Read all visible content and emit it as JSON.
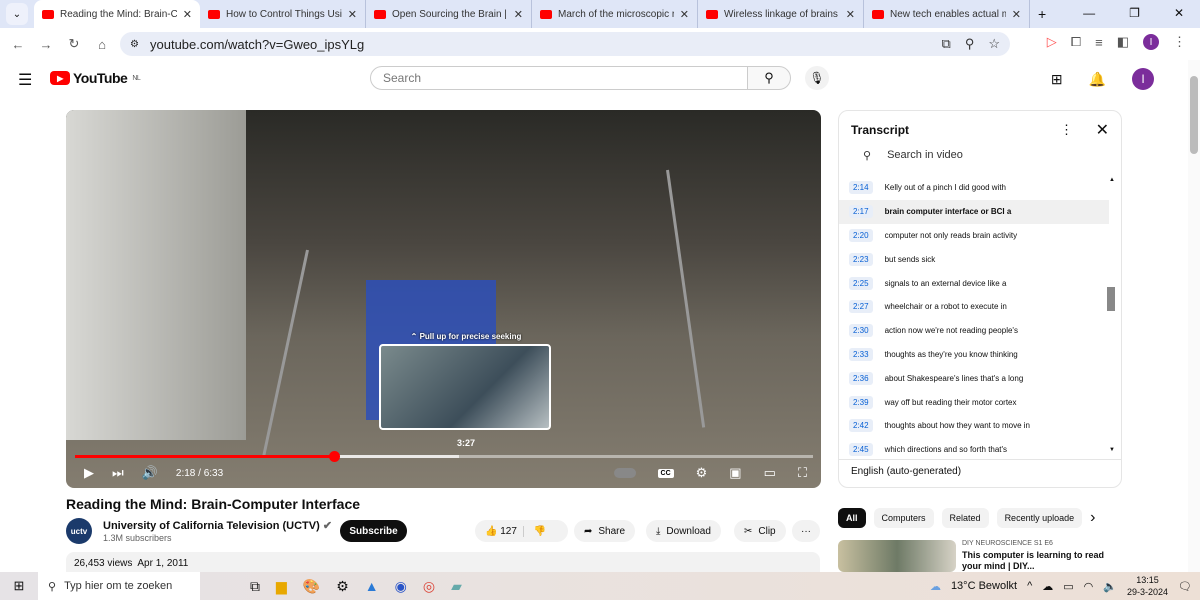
{
  "browser": {
    "tabs": [
      {
        "title": "Reading the Mind: Brain-C",
        "active": true
      },
      {
        "title": "How to Control Things Usi"
      },
      {
        "title": "Open Sourcing the Brain |"
      },
      {
        "title": "March of the microscopic r"
      },
      {
        "title": "Wireless linkage of brains r"
      },
      {
        "title": "New tech enables actual m"
      }
    ],
    "url": "youtube.com/watch?v=Gweo_ipsYLg",
    "profile_initial": "I"
  },
  "youtube": {
    "logo_text": "YouTube",
    "region": "NL",
    "search_placeholder": "Search",
    "avatar_initial": "I"
  },
  "player": {
    "pull_hint": "Pull up for precise seeking",
    "hover_time": "3:27",
    "current_time": "2:18",
    "duration": "6:33",
    "time_display": "2:18 / 6:33",
    "progress_fraction": 0.351,
    "cc_label": "CC",
    "accent_color": "#ff0000"
  },
  "video": {
    "title": "Reading the Mind: Brain-Computer Interface",
    "channel_logo": "uctv",
    "channel": "University of California Television (UCTV)",
    "subscribers": "1.3M subscribers",
    "subscribe_label": "Subscribe",
    "likes": "127",
    "share_label": "Share",
    "download_label": "Download",
    "clip_label": "Clip",
    "views": "26,453 views",
    "date": "Apr 1, 2011"
  },
  "transcript": {
    "title": "Transcript",
    "search_placeholder": "Search in video",
    "language": "English (auto-generated)",
    "lines": [
      {
        "t": "2:14",
        "text": "Kelly out of a pinch I did good with"
      },
      {
        "t": "2:17",
        "text": "brain computer interface or BCI a",
        "active": true
      },
      {
        "t": "2:20",
        "text": "computer not only reads brain activity"
      },
      {
        "t": "2:23",
        "text": "but sends sick"
      },
      {
        "t": "2:25",
        "text": "signals to an external device like a"
      },
      {
        "t": "2:27",
        "text": "wheelchair or a robot to execute in"
      },
      {
        "t": "2:30",
        "text": "action now we're not reading people's"
      },
      {
        "t": "2:33",
        "text": "thoughts as they're you know thinking"
      },
      {
        "t": "2:36",
        "text": "about Shakespeare's lines that's a long"
      },
      {
        "t": "2:39",
        "text": "way off but reading their motor cortex"
      },
      {
        "t": "2:42",
        "text": "thoughts about how they want to move in"
      },
      {
        "t": "2:45",
        "text": "which directions and so forth that's"
      }
    ]
  },
  "chips": [
    "All",
    "Computers",
    "Related",
    "Recently uploade"
  ],
  "recommendation": {
    "meta": "DIY NEUROSCIENCE  S1 E6",
    "title": "This computer is learning to read your mind | DIY..."
  },
  "taskbar": {
    "search_placeholder": "Typ hier om te zoeken",
    "weather": "13°C  Bewolkt",
    "time": "13:15",
    "date": "29-3-2024"
  }
}
